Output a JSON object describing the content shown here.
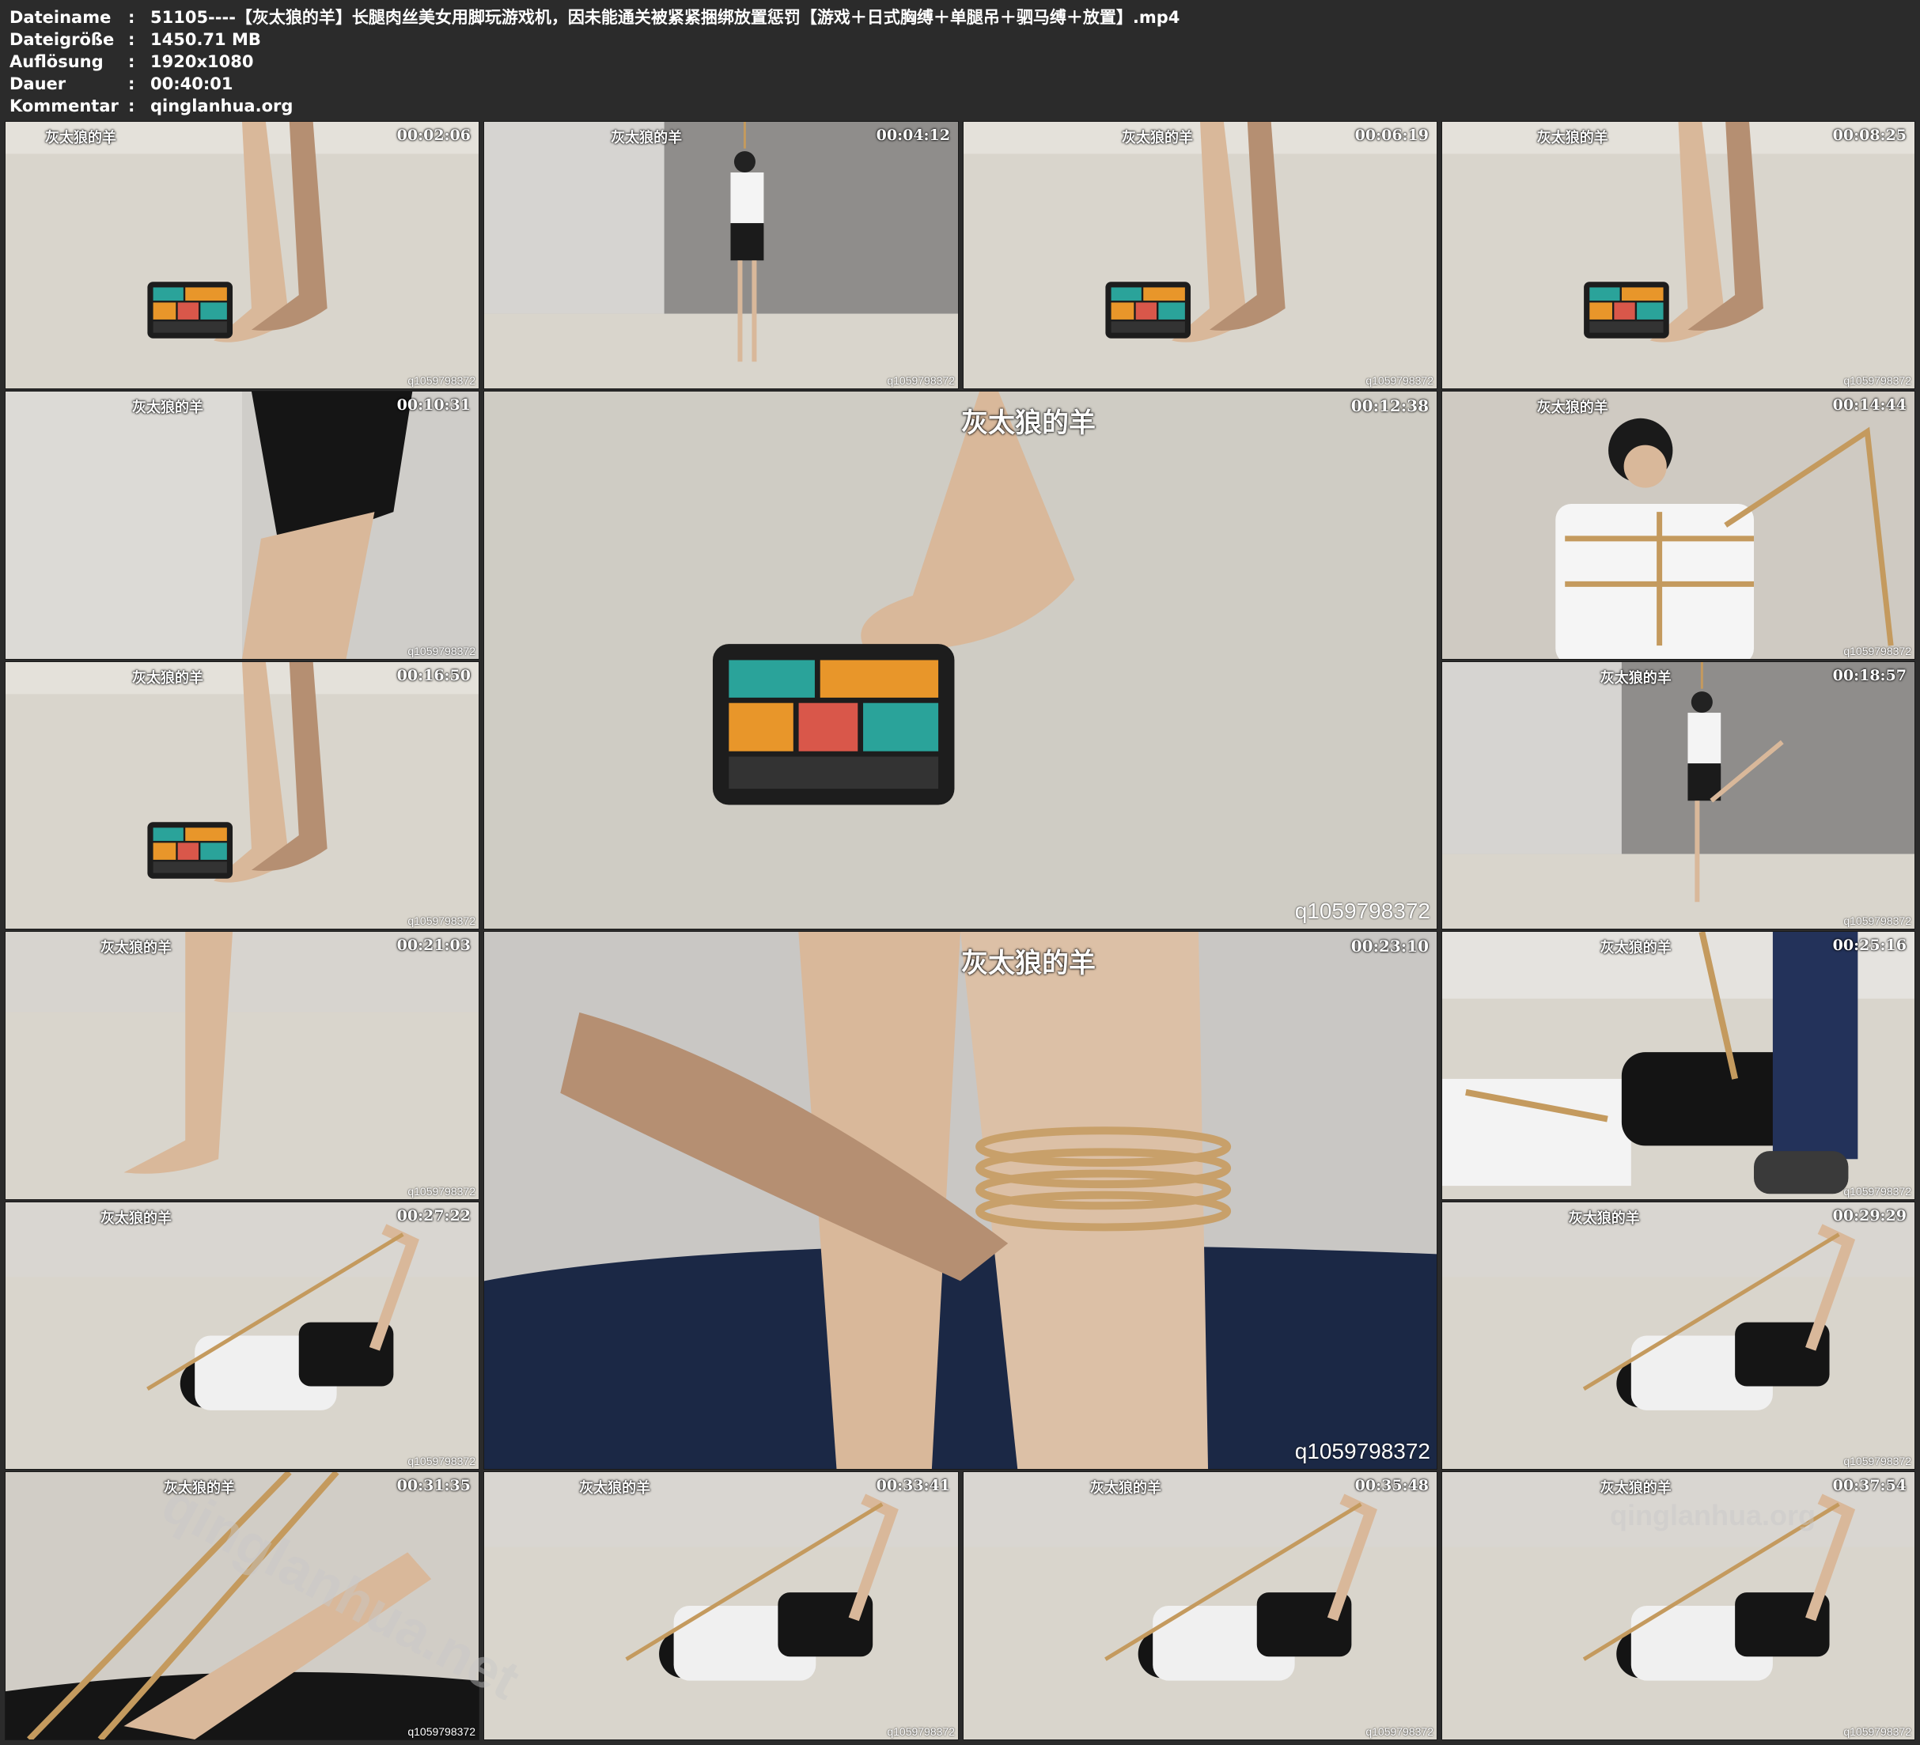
{
  "info": [
    {
      "key": "Dateiname",
      "sep": ":",
      "value": "51105----【灰太狼的羊】长腿肉丝美女用脚玩游戏机，因未能通关被紧紧捆绑放置惩罚【游戏＋日式胸缚＋单腿吊＋驷马缚＋放置】.mp4"
    },
    {
      "key": "Dateigröße",
      "sep": ":",
      "value": "1450.71 MB"
    },
    {
      "key": "Auflösung",
      "sep": ":",
      "value": "1920x1080"
    },
    {
      "key": "Dauer",
      "sep": ":",
      "value": "00:40:01"
    },
    {
      "key": "Kommentar",
      "sep": ":",
      "value": "qinglanhua.org"
    }
  ],
  "channel_mark": "灰太狼的羊",
  "uploader_id": "q1059798372",
  "thumbnails": [
    {
      "time": "00:02:06",
      "scene": "feet-game"
    },
    {
      "time": "00:04:12",
      "scene": "standing-tied"
    },
    {
      "time": "00:06:19",
      "scene": "feet-game"
    },
    {
      "time": "00:08:25",
      "scene": "feet-game"
    },
    {
      "time": "00:10:31",
      "scene": "skirt-leg"
    },
    {
      "time": "00:12:38",
      "scene": "game-closeup"
    },
    {
      "time": "00:14:44",
      "scene": "chest-tie"
    },
    {
      "time": "00:16:50",
      "scene": "feet-game"
    },
    {
      "time": "00:18:57",
      "scene": "leg-suspend"
    },
    {
      "time": "00:21:03",
      "scene": "leg-floor"
    },
    {
      "time": "00:23:10",
      "scene": "rope-closeup"
    },
    {
      "time": "00:25:16",
      "scene": "floor-tie"
    },
    {
      "time": "00:27:22",
      "scene": "hogtie"
    },
    {
      "time": "00:29:29",
      "scene": "hogtie"
    },
    {
      "time": "00:31:35",
      "scene": "rope-feet"
    },
    {
      "time": "00:33:41",
      "scene": "hogtie-side"
    },
    {
      "time": "00:35:48",
      "scene": "hogtie-side"
    },
    {
      "time": "00:37:54",
      "scene": "hogtie-side"
    }
  ],
  "overlay_watermarks": [
    "qinglanhua.net",
    "qinglanhua.org"
  ]
}
